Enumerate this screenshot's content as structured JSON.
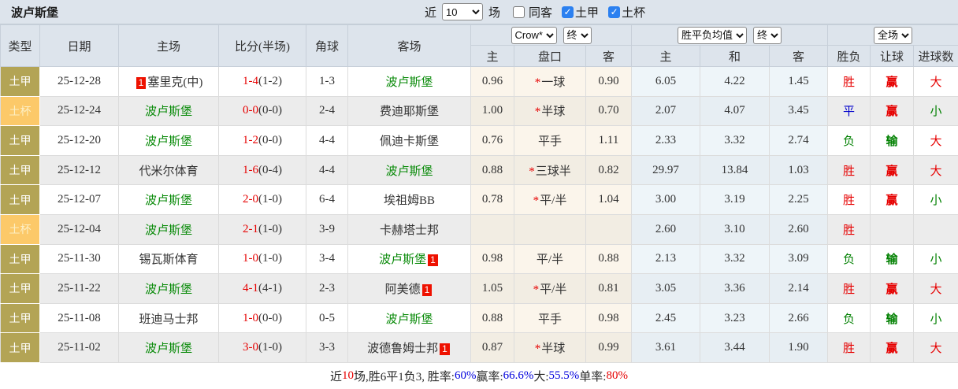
{
  "title": "波卢斯堡",
  "topbar": {
    "recent_label": "近",
    "recent_value": "10",
    "matches_label": "场",
    "same_away_label": "同客",
    "same_away_checked": false,
    "league_label": "土甲",
    "league_checked": true,
    "cup_label": "土杯",
    "cup_checked": true
  },
  "header": {
    "col_type": "类型",
    "col_date": "日期",
    "col_home": "主场",
    "col_score": "比分(半场)",
    "col_corner": "角球",
    "col_away": "客场",
    "bookmaker_select": "Crow*",
    "final_select1": "终",
    "avg_select": "胜平负均值",
    "final_select2": "终",
    "scope_select": "全场",
    "sub": [
      "主",
      "盘口",
      "客",
      "主",
      "和",
      "客",
      "胜负",
      "让球",
      "进球数"
    ]
  },
  "colors": {
    "accent_red": "#e60000",
    "accent_green": "#008000",
    "accent_blue": "#0000cc",
    "league_bg": "#b3a455",
    "cup_bg": "#fcc969",
    "checkbox_blue": "#2b80f0"
  },
  "rows": [
    {
      "type": "土甲",
      "cup": false,
      "date": "25-12-28",
      "home": {
        "name": "塞里克(中)",
        "green": false,
        "badge": "1",
        "badge_pos": "before"
      },
      "score": "1-4",
      "half": "(1-2)",
      "corner": "1-3",
      "away": {
        "name": "波卢斯堡",
        "green": true,
        "badge": "",
        "badge_pos": ""
      },
      "ah": [
        "0.96",
        "*一球",
        "0.90"
      ],
      "eu": [
        "6.05",
        "4.22",
        "1.45"
      ],
      "res": [
        [
          "胜",
          "r"
        ],
        [
          "赢",
          "r"
        ],
        [
          "大",
          "r"
        ]
      ]
    },
    {
      "type": "土杯",
      "cup": true,
      "date": "25-12-24",
      "home": {
        "name": "波卢斯堡",
        "green": true,
        "badge": "",
        "badge_pos": ""
      },
      "score": "0-0",
      "half": "(0-0)",
      "corner": "2-4",
      "away": {
        "name": "费迪耶斯堡",
        "green": false,
        "badge": "",
        "badge_pos": ""
      },
      "ah": [
        "1.00",
        "*半球",
        "0.70"
      ],
      "eu": [
        "2.07",
        "4.07",
        "3.45"
      ],
      "res": [
        [
          "平",
          "b"
        ],
        [
          "赢",
          "r"
        ],
        [
          "小",
          "g"
        ]
      ]
    },
    {
      "type": "土甲",
      "cup": false,
      "date": "25-12-20",
      "home": {
        "name": "波卢斯堡",
        "green": true,
        "badge": "",
        "badge_pos": ""
      },
      "score": "1-2",
      "half": "(0-0)",
      "corner": "4-4",
      "away": {
        "name": "佩迪卡斯堡",
        "green": false,
        "badge": "",
        "badge_pos": ""
      },
      "ah": [
        "0.76",
        "平手",
        "1.11"
      ],
      "eu": [
        "2.33",
        "3.32",
        "2.74"
      ],
      "res": [
        [
          "负",
          "g"
        ],
        [
          "输",
          "g"
        ],
        [
          "大",
          "r"
        ]
      ]
    },
    {
      "type": "土甲",
      "cup": false,
      "date": "25-12-12",
      "home": {
        "name": "代米尔体育",
        "green": false,
        "badge": "",
        "badge_pos": ""
      },
      "score": "1-6",
      "half": "(0-4)",
      "corner": "4-4",
      "away": {
        "name": "波卢斯堡",
        "green": true,
        "badge": "",
        "badge_pos": ""
      },
      "ah": [
        "0.88",
        "*三球半",
        "0.82"
      ],
      "eu": [
        "29.97",
        "13.84",
        "1.03"
      ],
      "res": [
        [
          "胜",
          "r"
        ],
        [
          "赢",
          "r"
        ],
        [
          "大",
          "r"
        ]
      ]
    },
    {
      "type": "土甲",
      "cup": false,
      "date": "25-12-07",
      "home": {
        "name": "波卢斯堡",
        "green": true,
        "badge": "",
        "badge_pos": ""
      },
      "score": "2-0",
      "half": "(1-0)",
      "corner": "6-4",
      "away": {
        "name": "埃祖姆BB",
        "green": false,
        "badge": "",
        "badge_pos": ""
      },
      "ah": [
        "0.78",
        "*平/半",
        "1.04"
      ],
      "eu": [
        "3.00",
        "3.19",
        "2.25"
      ],
      "res": [
        [
          "胜",
          "r"
        ],
        [
          "赢",
          "r"
        ],
        [
          "小",
          "g"
        ]
      ]
    },
    {
      "type": "土杯",
      "cup": true,
      "date": "25-12-04",
      "home": {
        "name": "波卢斯堡",
        "green": true,
        "badge": "",
        "badge_pos": ""
      },
      "score": "2-1",
      "half": "(1-0)",
      "corner": "3-9",
      "away": {
        "name": "卡赫塔士邦",
        "green": false,
        "badge": "",
        "badge_pos": ""
      },
      "ah": [
        "",
        "",
        ""
      ],
      "eu": [
        "2.60",
        "3.10",
        "2.60"
      ],
      "res": [
        [
          "胜",
          "r"
        ],
        [
          "",
          ""
        ],
        [
          "",
          ""
        ]
      ]
    },
    {
      "type": "土甲",
      "cup": false,
      "date": "25-11-30",
      "home": {
        "name": "锡瓦斯体育",
        "green": false,
        "badge": "",
        "badge_pos": ""
      },
      "score": "1-0",
      "half": "(1-0)",
      "corner": "3-4",
      "away": {
        "name": "波卢斯堡",
        "green": true,
        "badge": "1",
        "badge_pos": "after"
      },
      "ah": [
        "0.98",
        "平/半",
        "0.88"
      ],
      "eu": [
        "2.13",
        "3.32",
        "3.09"
      ],
      "res": [
        [
          "负",
          "g"
        ],
        [
          "输",
          "g"
        ],
        [
          "小",
          "g"
        ]
      ]
    },
    {
      "type": "土甲",
      "cup": false,
      "date": "25-11-22",
      "home": {
        "name": "波卢斯堡",
        "green": true,
        "badge": "",
        "badge_pos": ""
      },
      "score": "4-1",
      "half": "(4-1)",
      "corner": "2-3",
      "away": {
        "name": "阿美德",
        "green": false,
        "badge": "1",
        "badge_pos": "after"
      },
      "ah": [
        "1.05",
        "*平/半",
        "0.81"
      ],
      "eu": [
        "3.05",
        "3.36",
        "2.14"
      ],
      "res": [
        [
          "胜",
          "r"
        ],
        [
          "赢",
          "r"
        ],
        [
          "大",
          "r"
        ]
      ]
    },
    {
      "type": "土甲",
      "cup": false,
      "date": "25-11-08",
      "home": {
        "name": "班迪马士邦",
        "green": false,
        "badge": "",
        "badge_pos": ""
      },
      "score": "1-0",
      "half": "(0-0)",
      "corner": "0-5",
      "away": {
        "name": "波卢斯堡",
        "green": true,
        "badge": "",
        "badge_pos": ""
      },
      "ah": [
        "0.88",
        "平手",
        "0.98"
      ],
      "eu": [
        "2.45",
        "3.23",
        "2.66"
      ],
      "res": [
        [
          "负",
          "g"
        ],
        [
          "输",
          "g"
        ],
        [
          "小",
          "g"
        ]
      ]
    },
    {
      "type": "土甲",
      "cup": false,
      "date": "25-11-02",
      "home": {
        "name": "波卢斯堡",
        "green": true,
        "badge": "",
        "badge_pos": ""
      },
      "score": "3-0",
      "half": "(1-0)",
      "corner": "3-3",
      "away": {
        "name": "波德鲁姆士邦",
        "green": false,
        "badge": "1",
        "badge_pos": "after"
      },
      "ah": [
        "0.87",
        "*半球",
        "0.99"
      ],
      "eu": [
        "3.61",
        "3.44",
        "1.90"
      ],
      "res": [
        [
          "胜",
          "r"
        ],
        [
          "赢",
          "r"
        ],
        [
          "大",
          "r"
        ]
      ]
    }
  ],
  "footer": {
    "segments": [
      {
        "t": "近",
        "c": "dark"
      },
      {
        "t": "10",
        "c": "red"
      },
      {
        "t": "场,胜6平1负3, 胜率:",
        "c": "dark"
      },
      {
        "t": "60%",
        "c": "blue"
      },
      {
        "t": " 赢率:",
        "c": "dark"
      },
      {
        "t": "66.6%",
        "c": "blue"
      },
      {
        "t": " 大:",
        "c": "dark"
      },
      {
        "t": "55.5%",
        "c": "blue"
      },
      {
        "t": " 单率:",
        "c": "dark"
      },
      {
        "t": "80%",
        "c": "red"
      }
    ]
  }
}
